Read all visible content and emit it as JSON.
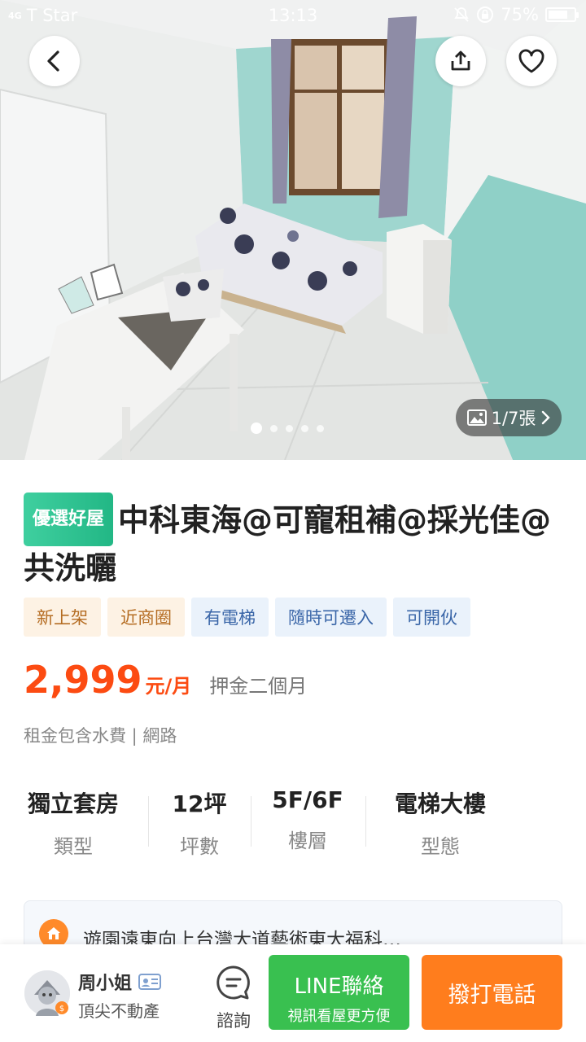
{
  "status_bar": {
    "network": "4G",
    "carrier": "T Star",
    "time": "13:13",
    "battery": "75%",
    "battery_level": 0.75
  },
  "gallery": {
    "photo_counter": "1/7張",
    "total_dots": 5,
    "active_dot": 1
  },
  "listing": {
    "badge": "優選好屋",
    "title": "中科東海@可寵租補@採光佳@共洗曬",
    "tags": [
      {
        "label": "新上架",
        "tone": "warm"
      },
      {
        "label": "近商圈",
        "tone": "warm"
      },
      {
        "label": "有電梯",
        "tone": "cool"
      },
      {
        "label": "隨時可遷入",
        "tone": "cool"
      },
      {
        "label": "可開伙",
        "tone": "cool"
      }
    ],
    "price": "2,999",
    "price_unit": "元/月",
    "deposit": "押金二個月",
    "includes": "租金包含水費 | 網路",
    "facts": [
      {
        "value": "獨立套房",
        "label": "類型"
      },
      {
        "value": "12坪",
        "label": "坪數"
      },
      {
        "value": "5F/6F",
        "label": "樓層"
      },
      {
        "value": "電梯大樓",
        "label": "型態"
      }
    ],
    "address": "遊園遠東向上台灣大道藝術東大福科…"
  },
  "contact": {
    "agent_name": "周小姐",
    "agent_company": "頂尖不動產",
    "consult_label": "諮詢",
    "line_label": "LINE聯絡",
    "line_sub": "視訊看屋更方便",
    "call_label": "撥打電話"
  },
  "colors": {
    "accent_orange": "#fc4b12",
    "line_green": "#39c050",
    "call_orange": "#ff7d1d",
    "premium_green": "#22b785"
  }
}
